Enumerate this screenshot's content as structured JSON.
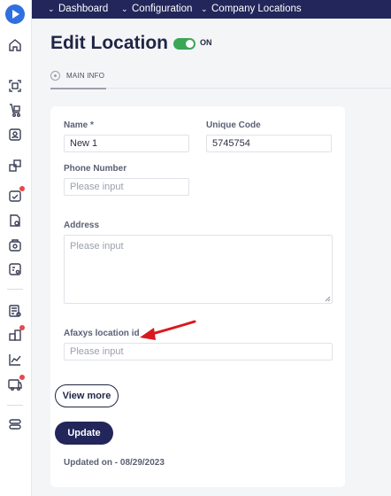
{
  "breadcrumb": [
    {
      "label": "Dashboard"
    },
    {
      "label": "Configuration"
    },
    {
      "label": "Company Locations"
    }
  ],
  "header": {
    "title": "Edit Location",
    "status_toggle": {
      "on": true,
      "label": "ON"
    }
  },
  "tabs": [
    {
      "label": "MAIN INFO",
      "active": true
    }
  ],
  "form": {
    "name": {
      "label": "Name *",
      "value": "New 1",
      "placeholder": ""
    },
    "unique_code": {
      "label": "Unique Code",
      "value": "5745754",
      "placeholder": ""
    },
    "phone": {
      "label": "Phone Number",
      "value": "",
      "placeholder": "Please input"
    },
    "address": {
      "label": "Address",
      "value": "",
      "placeholder": "Please input"
    },
    "afaxys_id": {
      "label": "Afaxys location id",
      "value": "",
      "placeholder": "Please input"
    }
  },
  "buttons": {
    "view_more": "View more",
    "update": "Update"
  },
  "footer": {
    "updated_text": "Updated on - 08/29/2023"
  },
  "sidebar": {
    "items": [
      {
        "icon": "home-icon"
      },
      {
        "icon": "scan-icon"
      },
      {
        "icon": "inventory-icon"
      },
      {
        "icon": "user-card-icon"
      },
      {
        "icon": "boxes-icon"
      },
      {
        "icon": "checklist-icon",
        "badge": true
      },
      {
        "icon": "document-settings-icon"
      },
      {
        "icon": "cart-icon"
      },
      {
        "icon": "settings-card-icon"
      },
      {
        "icon": "reports-icon"
      },
      {
        "icon": "building-icon",
        "badge": true
      },
      {
        "icon": "analytics-icon"
      },
      {
        "icon": "truck-icon",
        "badge": true
      },
      {
        "icon": "toggle-settings-icon"
      }
    ]
  },
  "colors": {
    "nav_bg": "#23265a",
    "toggle_on": "#3aa757",
    "logo": "#2f6fe0",
    "badge": "#e5484d",
    "arrow": "#d9181f"
  }
}
